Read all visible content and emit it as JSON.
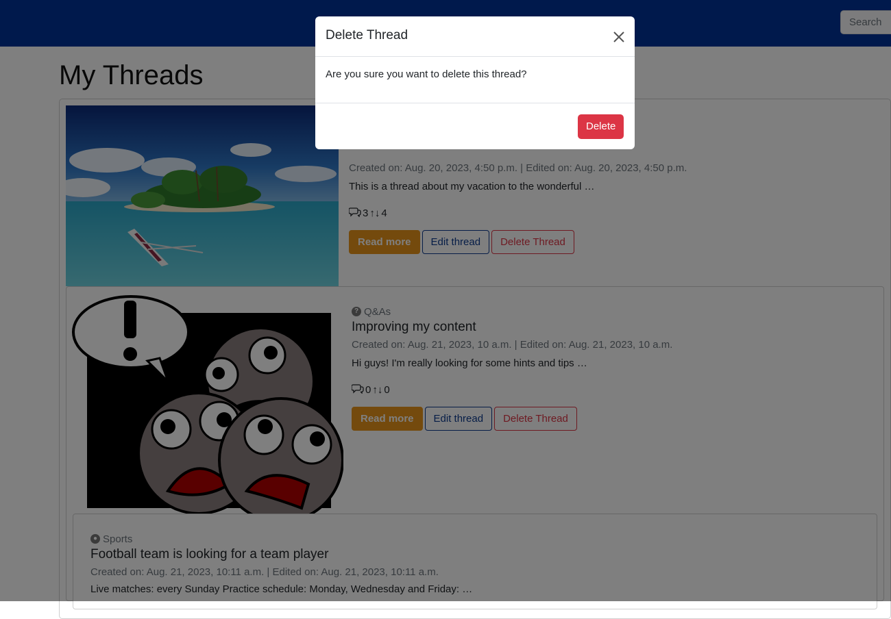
{
  "navbar": {
    "search_label": "Search"
  },
  "page": {
    "title": "My Threads"
  },
  "threads": [
    {
      "category": "",
      "title": "",
      "meta": "Created on: Aug. 20, 2023, 4:50 p.m. | Edited on: Aug. 20, 2023, 4:50 p.m.",
      "excerpt": "This is a thread about my vacation to the wonderful …",
      "comments": "3",
      "votes": "4",
      "read_more": "Read more",
      "edit": "Edit thread",
      "delete": "Delete Thread"
    },
    {
      "category": "Q&As",
      "title": "Improving my content",
      "meta": "Created on: Aug. 21, 2023, 10 a.m. | Edited on: Aug. 21, 2023, 10 a.m.",
      "excerpt": "Hi guys! I'm really looking for some hints and tips …",
      "comments": "0",
      "votes": "0",
      "read_more": "Read more",
      "edit": "Edit thread",
      "delete": "Delete Thread"
    },
    {
      "category": "Sports",
      "title": "Football team is looking for a team player",
      "meta": "Created on: Aug. 21, 2023, 10:11 a.m. | Edited on: Aug. 21, 2023, 10:11 a.m.",
      "excerpt": "Live matches: every Sunday Practice schedule: Monday, Wednesday and Friday: …"
    }
  ],
  "modal": {
    "title": "Delete Thread",
    "body": "Are you sure you want to delete this thread?",
    "confirm_label": "Delete"
  },
  "colors": {
    "navbar": "#003399",
    "primary_action": "#e8951a",
    "danger": "#dc3545",
    "outline_primary": "#0d3a8f"
  }
}
